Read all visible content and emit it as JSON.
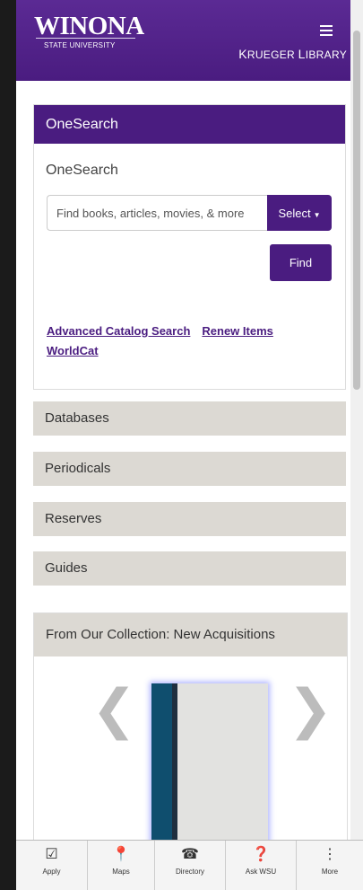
{
  "header": {
    "logo_main": "WINONA",
    "logo_sub": "STATE UNIVERSITY",
    "library_name_first": "K",
    "library_name_first_rest": "RUEGER ",
    "library_name_second": "L",
    "library_name_second_rest": "IBRARY"
  },
  "onesearch": {
    "panel_title": "OneSearch",
    "subheading": "OneSearch",
    "search_placeholder": "Find books, articles, movies, & more",
    "select_label": "Select",
    "find_label": "Find",
    "links": {
      "advanced": "Advanced Catalog Search",
      "renew": "Renew Items",
      "worldcat": "WorldCat"
    }
  },
  "accordion": [
    "Databases",
    "Periodicals",
    "Reserves",
    "Guides"
  ],
  "collection": {
    "title": "From Our Collection: New Acquisitions",
    "prev": "❮",
    "next": "❯"
  },
  "bottom_nav": [
    {
      "label": "Apply",
      "icon": "checkbox-icon"
    },
    {
      "label": "Maps",
      "icon": "map-marker-icon"
    },
    {
      "label": "Directory",
      "icon": "phone-icon"
    },
    {
      "label": "Ask WSU",
      "icon": "question-icon"
    },
    {
      "label": "More",
      "icon": "more-vertical-icon"
    }
  ],
  "colors": {
    "brand_purple": "#4a1c80",
    "accordion_gray": "#dcd9d3"
  }
}
